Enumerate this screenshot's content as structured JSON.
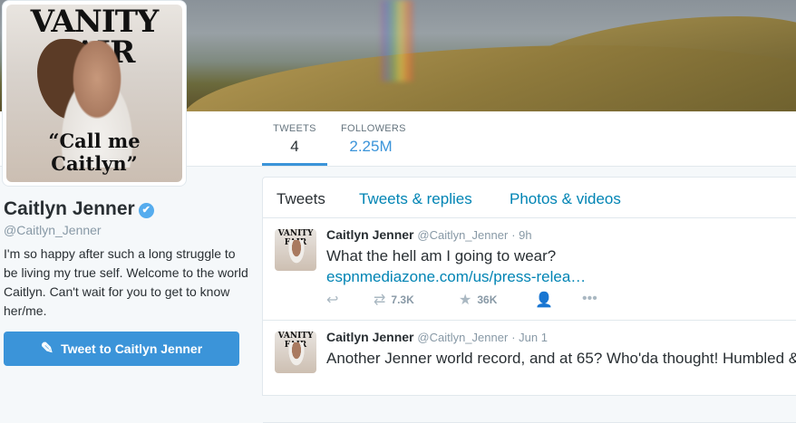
{
  "banner": {
    "alt": ""
  },
  "avatar": {
    "magazine": "VANITY FAIR",
    "cover_text": "“Call me Caitlyn”"
  },
  "stats": [
    {
      "label": "TWEETS",
      "value": "4"
    },
    {
      "label": "FOLLOWERS",
      "value": "2.25M"
    }
  ],
  "profile": {
    "name": "Caitlyn Jenner",
    "verified_icon": "✔",
    "handle": "@Caitlyn_Jenner",
    "bio": "I'm so happy after such a long struggle to be living my true self. Welcome to the world Caitlyn. Can't wait for you to get to know her/me.",
    "tweet_to_label": "Tweet to Caitlyn Jenner"
  },
  "tabs": [
    {
      "label": "Tweets"
    },
    {
      "label": "Tweets & replies"
    },
    {
      "label": "Photos & videos"
    }
  ],
  "tweets": [
    {
      "name": "Caitlyn Jenner",
      "handle": "@Caitlyn_Jenner",
      "time": "· 9h",
      "text": "What the hell am I going to wear?",
      "link": "espnmediazone.com/us/press-relea…",
      "retweets": "7.3K",
      "likes": "36K"
    },
    {
      "name": "Caitlyn Jenner",
      "handle": "@Caitlyn_Jenner",
      "time": "· Jun 1",
      "text": "Another Jenner world record, and at 65? Who'da thought! Humbled &"
    }
  ],
  "colors": {
    "accent": "#3b94d9",
    "link": "#0084b4",
    "muted": "#8899a6"
  }
}
